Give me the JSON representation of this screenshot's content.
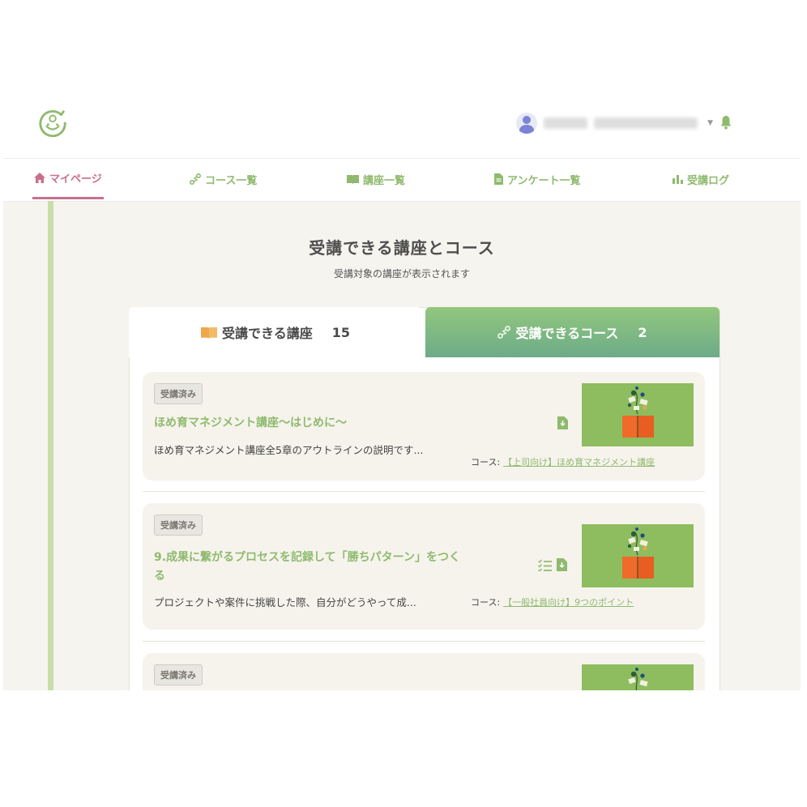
{
  "nav": {
    "items": [
      {
        "label": "マイページ",
        "icon": "home-icon",
        "active": true
      },
      {
        "label": "コース一覧",
        "icon": "route-icon",
        "active": false
      },
      {
        "label": "講座一覧",
        "icon": "book-icon",
        "active": false
      },
      {
        "label": "アンケート一覧",
        "icon": "document-icon",
        "active": false
      },
      {
        "label": "受講ログ",
        "icon": "bar-chart-icon",
        "active": false
      }
    ]
  },
  "page": {
    "title": "受講できる講座とコース",
    "subtitle": "受講対象の講座が表示されます"
  },
  "tabs": {
    "lectures": {
      "label": "受講できる講座",
      "count": "15"
    },
    "courses": {
      "label": "受講できるコース",
      "count": "2"
    }
  },
  "course_prefix": "コース:",
  "cards": [
    {
      "badge": "受講済み",
      "title": "ほめ育マネジメント講座〜はじめに〜",
      "description": "ほめ育マネジメント講座全5章のアウトラインの説明です...",
      "course": "【上司向け】ほめ育マネジメント講座"
    },
    {
      "badge": "受講済み",
      "title": "9.成果に繋がるプロセスを記録して「勝ちパターン」をつくる",
      "description": "プロジェクトや案件に挑戦した際、自分がどうやって成...",
      "course": "【一般社員向け】9つのポイント"
    },
    {
      "badge": "受講済み"
    }
  ],
  "colors": {
    "accent_green": "#8fba6e",
    "active_pink": "#c8708c",
    "background": "#f6f4ef",
    "thumbnail_green": "#8dbd5e"
  }
}
